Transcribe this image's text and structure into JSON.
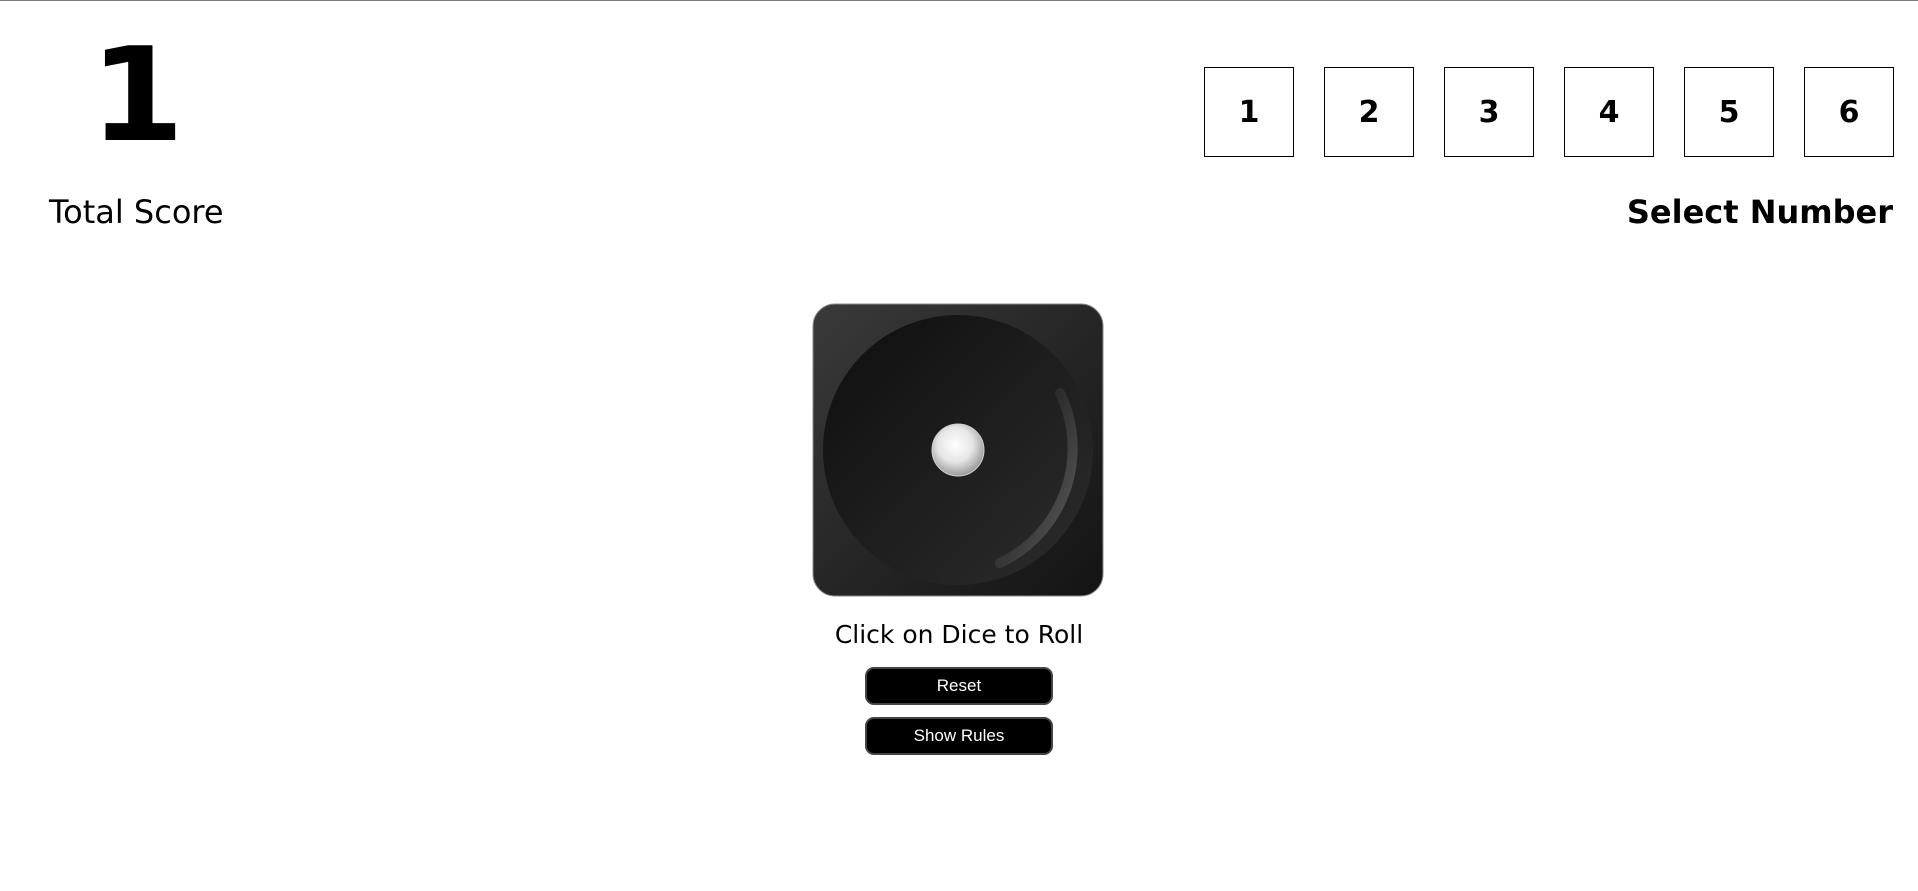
{
  "score": {
    "value": "1",
    "label": "Total Score"
  },
  "selector": {
    "numbers": [
      "1",
      "2",
      "3",
      "4",
      "5",
      "6"
    ],
    "label": "Select Number"
  },
  "dice": {
    "face_value": 1,
    "icon": "dice-one-icon"
  },
  "instructions": {
    "caption": "Click on Dice to Roll"
  },
  "buttons": {
    "reset_label": "Reset",
    "rules_label": "Show Rules"
  }
}
